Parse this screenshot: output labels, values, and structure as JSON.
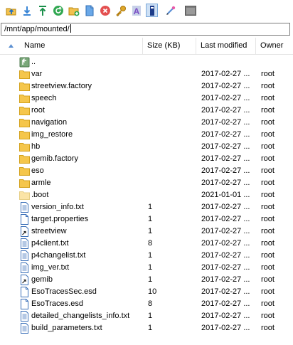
{
  "toolbar": {
    "icons": [
      "upload-icon",
      "download-icon",
      "go-top-icon",
      "refresh-icon",
      "new-folder-icon",
      "new-file-icon",
      "delete-icon",
      "permissions-icon",
      "rename-icon",
      "toggle-view-icon",
      "edit-icon",
      "terminal-icon"
    ]
  },
  "path": {
    "value": "/mnt/app/mounted/"
  },
  "columns": {
    "name": "Name",
    "size": "Size (KB)",
    "modified": "Last modified",
    "owner": "Owner"
  },
  "rows": [
    {
      "type": "parent",
      "name": "..",
      "size": "",
      "modified": "",
      "owner": ""
    },
    {
      "type": "folder",
      "name": "var",
      "size": "",
      "modified": "2017-02-27 ...",
      "owner": "root"
    },
    {
      "type": "folder",
      "name": "streetview.factory",
      "size": "",
      "modified": "2017-02-27 ...",
      "owner": "root"
    },
    {
      "type": "folder",
      "name": "speech",
      "size": "",
      "modified": "2017-02-27 ...",
      "owner": "root"
    },
    {
      "type": "folder",
      "name": "root",
      "size": "",
      "modified": "2017-02-27 ...",
      "owner": "root"
    },
    {
      "type": "folder",
      "name": "navigation",
      "size": "",
      "modified": "2017-02-27 ...",
      "owner": "root"
    },
    {
      "type": "folder",
      "name": "img_restore",
      "size": "",
      "modified": "2017-02-27 ...",
      "owner": "root"
    },
    {
      "type": "folder",
      "name": "hb",
      "size": "",
      "modified": "2017-02-27 ...",
      "owner": "root"
    },
    {
      "type": "folder",
      "name": "gemib.factory",
      "size": "",
      "modified": "2017-02-27 ...",
      "owner": "root"
    },
    {
      "type": "folder",
      "name": "eso",
      "size": "",
      "modified": "2017-02-27 ...",
      "owner": "root"
    },
    {
      "type": "folder",
      "name": "armle",
      "size": "",
      "modified": "2017-02-27 ...",
      "owner": "root"
    },
    {
      "type": "folder-hidden",
      "name": ".boot",
      "size": "",
      "modified": "2021-01-01 ...",
      "owner": "root"
    },
    {
      "type": "text",
      "name": "version_info.txt",
      "size": "1",
      "modified": "2017-02-27 ...",
      "owner": "root"
    },
    {
      "type": "file",
      "name": "target.properties",
      "size": "1",
      "modified": "2017-02-27 ...",
      "owner": "root"
    },
    {
      "type": "link",
      "name": "streetview",
      "size": "1",
      "modified": "2017-02-27 ...",
      "owner": "root"
    },
    {
      "type": "text",
      "name": "p4client.txt",
      "size": "8",
      "modified": "2017-02-27 ...",
      "owner": "root"
    },
    {
      "type": "text",
      "name": "p4changelist.txt",
      "size": "1",
      "modified": "2017-02-27 ...",
      "owner": "root"
    },
    {
      "type": "text",
      "name": "img_ver.txt",
      "size": "1",
      "modified": "2017-02-27 ...",
      "owner": "root"
    },
    {
      "type": "link",
      "name": "gemib",
      "size": "1",
      "modified": "2017-02-27 ...",
      "owner": "root"
    },
    {
      "type": "file",
      "name": "EsoTracesSec.esd",
      "size": "10",
      "modified": "2017-02-27 ...",
      "owner": "root"
    },
    {
      "type": "file",
      "name": "EsoTraces.esd",
      "size": "8",
      "modified": "2017-02-27 ...",
      "owner": "root"
    },
    {
      "type": "text",
      "name": "detailed_changelists_info.txt",
      "size": "1",
      "modified": "2017-02-27 ...",
      "owner": "root"
    },
    {
      "type": "text",
      "name": "build_parameters.txt",
      "size": "1",
      "modified": "2017-02-27 ...",
      "owner": "root"
    }
  ]
}
